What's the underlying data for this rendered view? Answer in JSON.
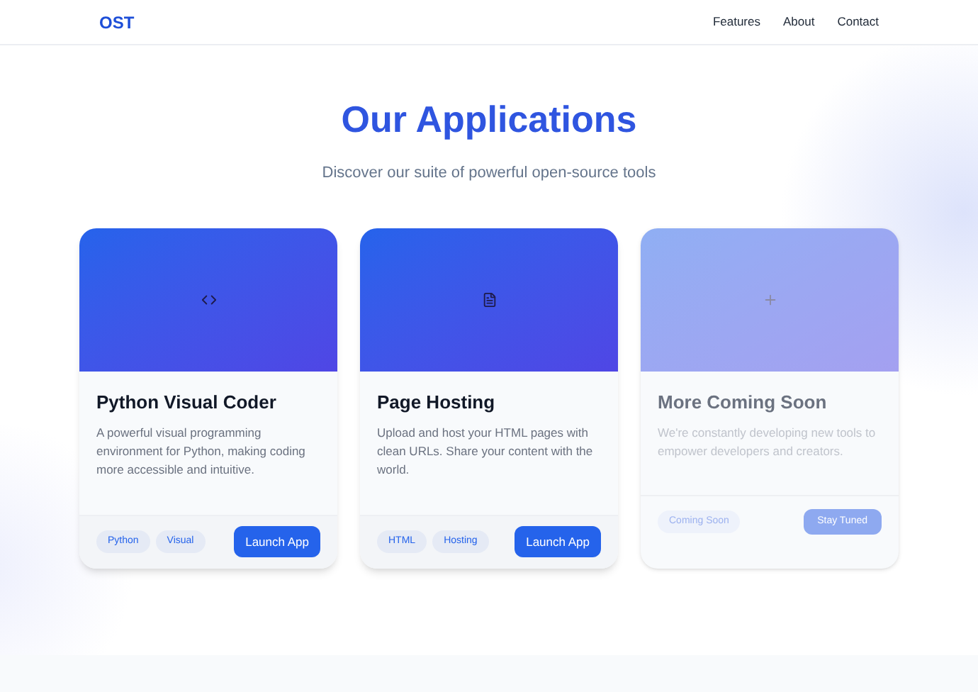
{
  "nav": {
    "logo": "OST",
    "links": [
      "Features",
      "About",
      "Contact"
    ]
  },
  "hero": {
    "title": "Our Applications",
    "subtitle": "Discover our suite of powerful open-source tools"
  },
  "cards": [
    {
      "kind": "code",
      "disabled": false,
      "title": "Python Visual Coder",
      "description": "A powerful visual programming environment for Python, making coding more accessible and intuitive.",
      "tags": [
        "Python",
        "Visual"
      ],
      "button": "Launch App"
    },
    {
      "kind": "document",
      "disabled": false,
      "title": "Page Hosting",
      "description": "Upload and host your HTML pages with clean URLs. Share your content with the world.",
      "tags": [
        "HTML",
        "Hosting"
      ],
      "button": "Launch App"
    },
    {
      "kind": "plus",
      "disabled": true,
      "title": "More Coming Soon",
      "description": "We're constantly developing new tools to empower developers and creators.",
      "tags": [
        "Coming Soon"
      ],
      "button": "Stay Tuned"
    }
  ]
}
